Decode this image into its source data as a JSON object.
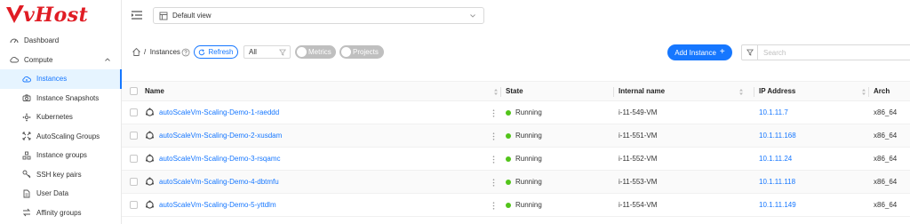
{
  "brand": {
    "name": "vHost",
    "accent": "#e01c24"
  },
  "topbar": {
    "view_label": "Default view"
  },
  "sidebar": {
    "items": [
      {
        "label": "Dashboard",
        "icon": "dashboard-icon"
      },
      {
        "label": "Compute",
        "icon": "cloud-icon",
        "expanded": true
      },
      {
        "label": "Instances",
        "icon": "cloud-server-icon",
        "active": true
      },
      {
        "label": "Instance Snapshots",
        "icon": "camera-icon"
      },
      {
        "label": "Kubernetes",
        "icon": "cluster-icon"
      },
      {
        "label": "AutoScaling Groups",
        "icon": "expand-arrows-icon"
      },
      {
        "label": "Instance groups",
        "icon": "group-icon"
      },
      {
        "label": "SSH key pairs",
        "icon": "key-icon"
      },
      {
        "label": "User Data",
        "icon": "document-icon"
      },
      {
        "label": "Affinity groups",
        "icon": "swap-icon"
      }
    ]
  },
  "toolbar": {
    "breadcrumb_sep": "/",
    "breadcrumb_label": "Instances",
    "refresh_label": "Refresh",
    "filter_value": "All",
    "metrics_label": "Metrics",
    "metrics_on": false,
    "projects_label": "Projects",
    "projects_on": false,
    "add_label": "Add Instance",
    "add_plus": "+",
    "search_placeholder": "Search"
  },
  "table": {
    "columns": [
      "Name",
      "State",
      "Internal name",
      "IP Address",
      "Arch"
    ],
    "rows": [
      {
        "name": "autoScaleVm-Scaling-Demo-1-raeddd",
        "state": "Running",
        "internal": "i-11-549-VM",
        "ip": "10.1.11.7",
        "arch": "x86_64"
      },
      {
        "name": "autoScaleVm-Scaling-Demo-2-xusdam",
        "state": "Running",
        "internal": "i-11-551-VM",
        "ip": "10.1.11.168",
        "arch": "x86_64"
      },
      {
        "name": "autoScaleVm-Scaling-Demo-3-rsqamc",
        "state": "Running",
        "internal": "i-11-552-VM",
        "ip": "10.1.11.24",
        "arch": "x86_64"
      },
      {
        "name": "autoScaleVm-Scaling-Demo-4-dbtmfu",
        "state": "Running",
        "internal": "i-11-553-VM",
        "ip": "10.1.11.118",
        "arch": "x86_64"
      },
      {
        "name": "autoScaleVm-Scaling-Demo-5-yttdlm",
        "state": "Running",
        "internal": "i-11-554-VM",
        "ip": "10.1.11.149",
        "arch": "x86_64"
      }
    ]
  },
  "colors": {
    "primary": "#1677ff",
    "running": "#52c41a"
  }
}
